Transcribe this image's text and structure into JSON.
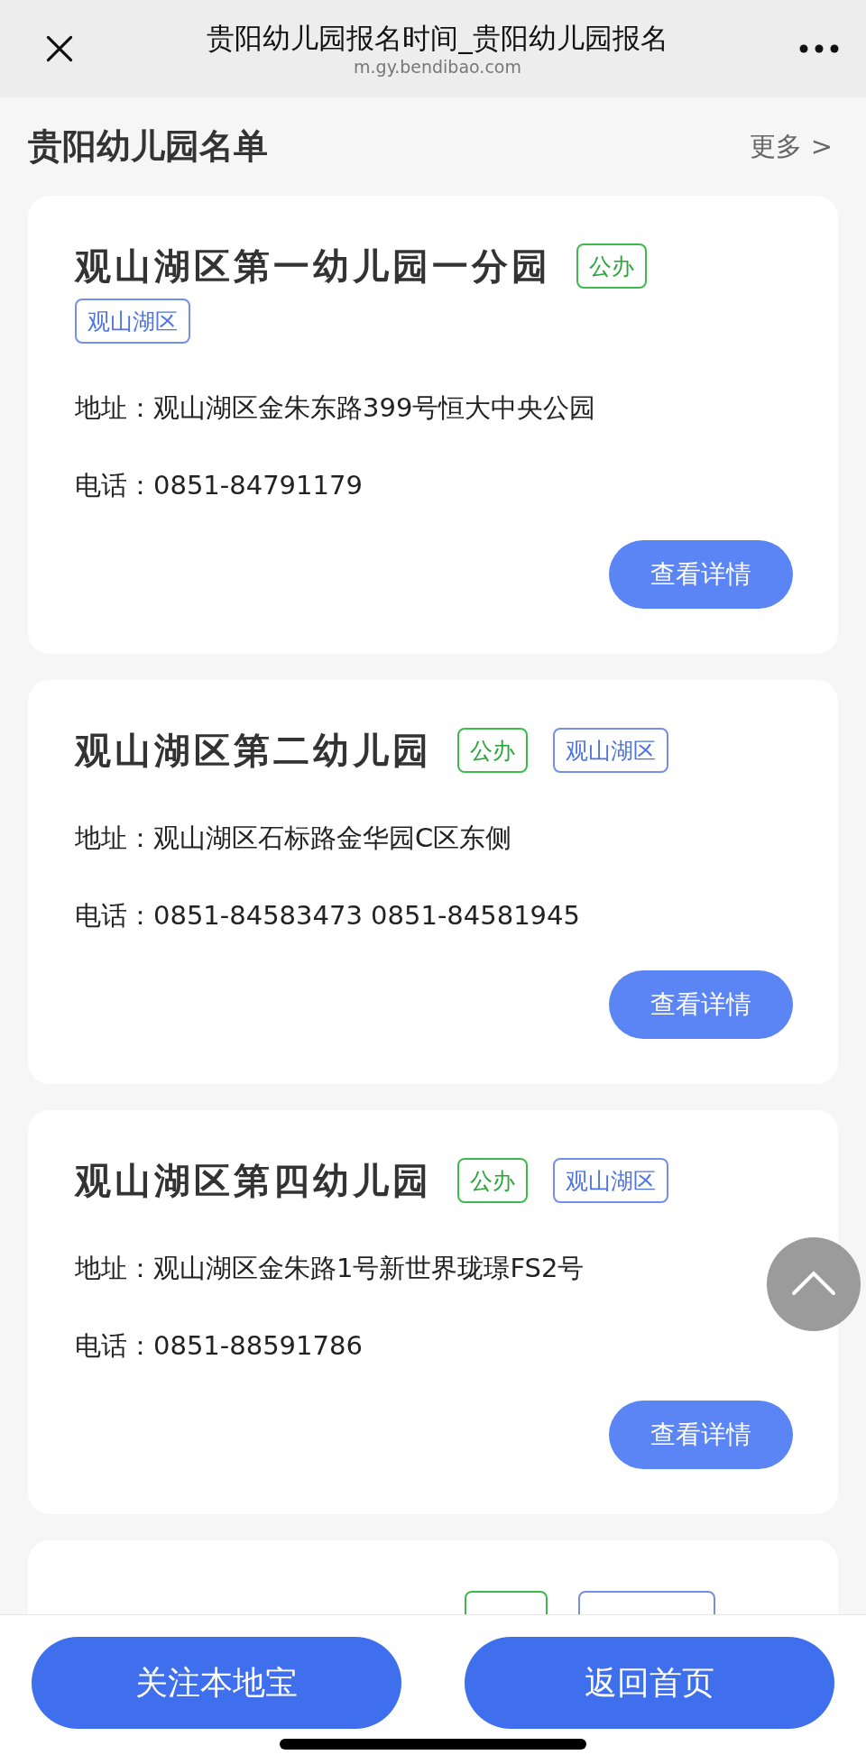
{
  "top_bar": {
    "title": "贵阳幼儿园报名时间_贵阳幼儿园报名",
    "url": "m.gy.bendibao.com"
  },
  "section": {
    "heading": "贵阳幼儿园名单",
    "more_link": "更多 >"
  },
  "kindergartens": [
    {
      "name": "观山湖区第一幼儿园一分园",
      "tags": [
        {
          "label": "公办",
          "kind": "type"
        },
        {
          "label": "观山湖区",
          "kind": "district"
        }
      ],
      "address": "地址：观山湖区金朱东路399号恒大中央公园",
      "phone": "电话：0851-84791179",
      "button": "查看详情"
    },
    {
      "name": "观山湖区第二幼儿园",
      "tags": [
        {
          "label": "公办",
          "kind": "type"
        },
        {
          "label": "观山湖区",
          "kind": "district"
        }
      ],
      "address": "地址：观山湖区石标路金华园C区东侧",
      "phone": "电话：0851-84583473 0851-84581945",
      "button": "查看详情"
    },
    {
      "name": "观山湖区第四幼儿园",
      "tags": [
        {
          "label": "公办",
          "kind": "type"
        },
        {
          "label": "观山湖区",
          "kind": "district"
        }
      ],
      "address": "地址：观山湖区金朱路1号新世界珑璟FS2号",
      "phone": "电话：0851-88591786",
      "button": "查看详情"
    }
  ],
  "bottom_buttons": [
    "关注本地宝",
    "返回首页"
  ]
}
